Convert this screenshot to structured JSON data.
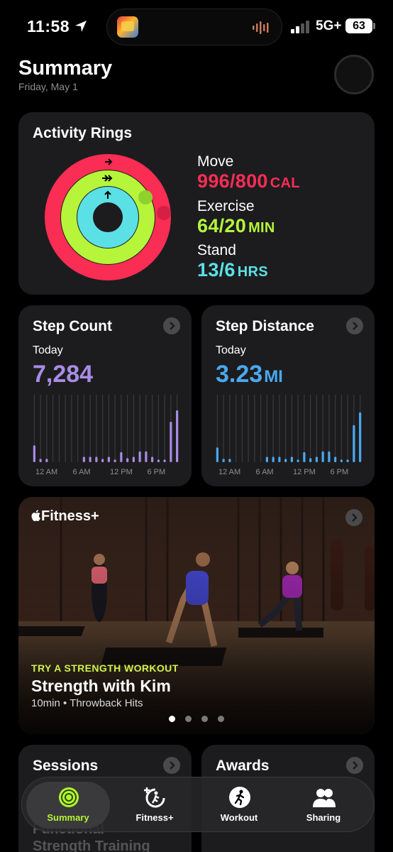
{
  "status_bar": {
    "time": "11:58",
    "network": "5G+",
    "battery": "63"
  },
  "header": {
    "title": "Summary",
    "date": "Friday, May 1"
  },
  "activity": {
    "title": "Activity Rings",
    "move": {
      "label": "Move",
      "value": "996/800",
      "unit": "CAL",
      "color": "#fa2d55",
      "progress": 1.245
    },
    "exercise": {
      "label": "Exercise",
      "value": "64/20",
      "unit": "MIN",
      "color": "#b6f53a",
      "progress": 3.2
    },
    "stand": {
      "label": "Stand",
      "value": "13/6",
      "unit": "HRS",
      "color": "#5be0e6",
      "progress": 2.17
    }
  },
  "step_count": {
    "title": "Step Count",
    "period": "Today",
    "value": "7,284",
    "color": "#a98ce6",
    "axis": [
      "12 AM",
      "6 AM",
      "12 PM",
      "6 PM"
    ],
    "chart_data": {
      "type": "bar",
      "values": [
        0.25,
        0.05,
        0.05,
        0,
        0,
        0,
        0,
        0,
        0.08,
        0.08,
        0.08,
        0.05,
        0.08,
        0.04,
        0.15,
        0.06,
        0.08,
        0.16,
        0.16,
        0.08,
        0.04,
        0.04,
        0.6,
        0.77
      ],
      "ylim": [
        0,
        1
      ]
    }
  },
  "step_distance": {
    "title": "Step Distance",
    "period": "Today",
    "value": "3.23",
    "unit": "MI",
    "color": "#4aa8f0",
    "axis": [
      "12 AM",
      "6 AM",
      "12 PM",
      "6 PM"
    ],
    "chart_data": {
      "type": "bar",
      "values": [
        0.22,
        0.05,
        0.05,
        0,
        0,
        0,
        0,
        0,
        0.08,
        0.08,
        0.08,
        0.05,
        0.08,
        0.04,
        0.15,
        0.06,
        0.08,
        0.16,
        0.16,
        0.08,
        0.04,
        0.04,
        0.55,
        0.74
      ],
      "ylim": [
        0,
        1
      ]
    }
  },
  "fitness_plus": {
    "brand": "Fitness+",
    "kicker": "TRY A STRENGTH WORKOUT",
    "workout": "Strength with Kim",
    "meta": "10min • Throwback Hits",
    "page_count": 4,
    "active_page": 1
  },
  "sessions": {
    "title": "Sessions",
    "ghost_1": "Functional",
    "ghost_2": "Strength Training"
  },
  "awards": {
    "title": "Awards"
  },
  "tabs": [
    {
      "label": "Summary",
      "icon": "rings-icon",
      "active": true
    },
    {
      "label": "Fitness+",
      "icon": "fitness-plus-icon",
      "active": false
    },
    {
      "label": "Workout",
      "icon": "runner-icon",
      "active": false
    },
    {
      "label": "Sharing",
      "icon": "people-icon",
      "active": false
    }
  ]
}
